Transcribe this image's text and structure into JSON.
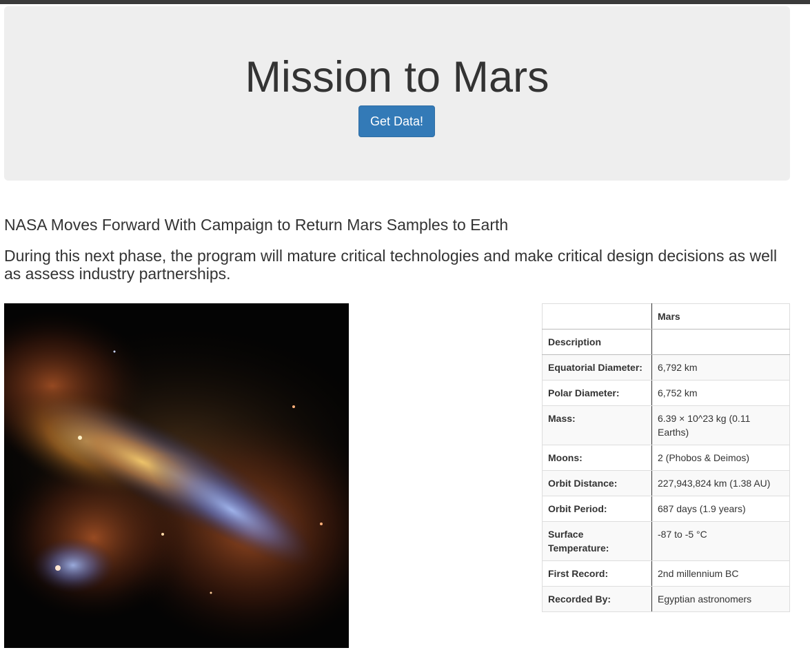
{
  "header": {
    "title": "Mission to Mars",
    "button_label": "Get Data!"
  },
  "news": {
    "title": "NASA Moves Forward With Campaign to Return Mars Samples to Earth",
    "teaser": "During this next phase, the program will mature critical technologies and make critical design decisions as well as assess industry partnerships."
  },
  "facts_table": {
    "columns": [
      "",
      "Mars"
    ],
    "rows": [
      {
        "label": "Description",
        "value": ""
      },
      {
        "label": "Equatorial Diameter:",
        "value": "6,792 km"
      },
      {
        "label": "Polar Diameter:",
        "value": "6,752 km"
      },
      {
        "label": "Mass:",
        "value": "6.39 × 10^23 kg (0.11 Earths)"
      },
      {
        "label": "Moons:",
        "value": "2 (Phobos & Deimos)"
      },
      {
        "label": "Orbit Distance:",
        "value": "227,943,824 km (1.38 AU)"
      },
      {
        "label": "Orbit Period:",
        "value": "687 days (1.9 years)"
      },
      {
        "label": "Surface Temperature:",
        "value": "-87 to -5 °C"
      },
      {
        "label": "First Record:",
        "value": "2nd millennium BC"
      },
      {
        "label": "Recorded By:",
        "value": "Egyptian astronomers"
      }
    ]
  },
  "colors": {
    "primary_button": "#337ab7",
    "jumbotron_bg": "#eeeeee",
    "text": "#333333"
  }
}
